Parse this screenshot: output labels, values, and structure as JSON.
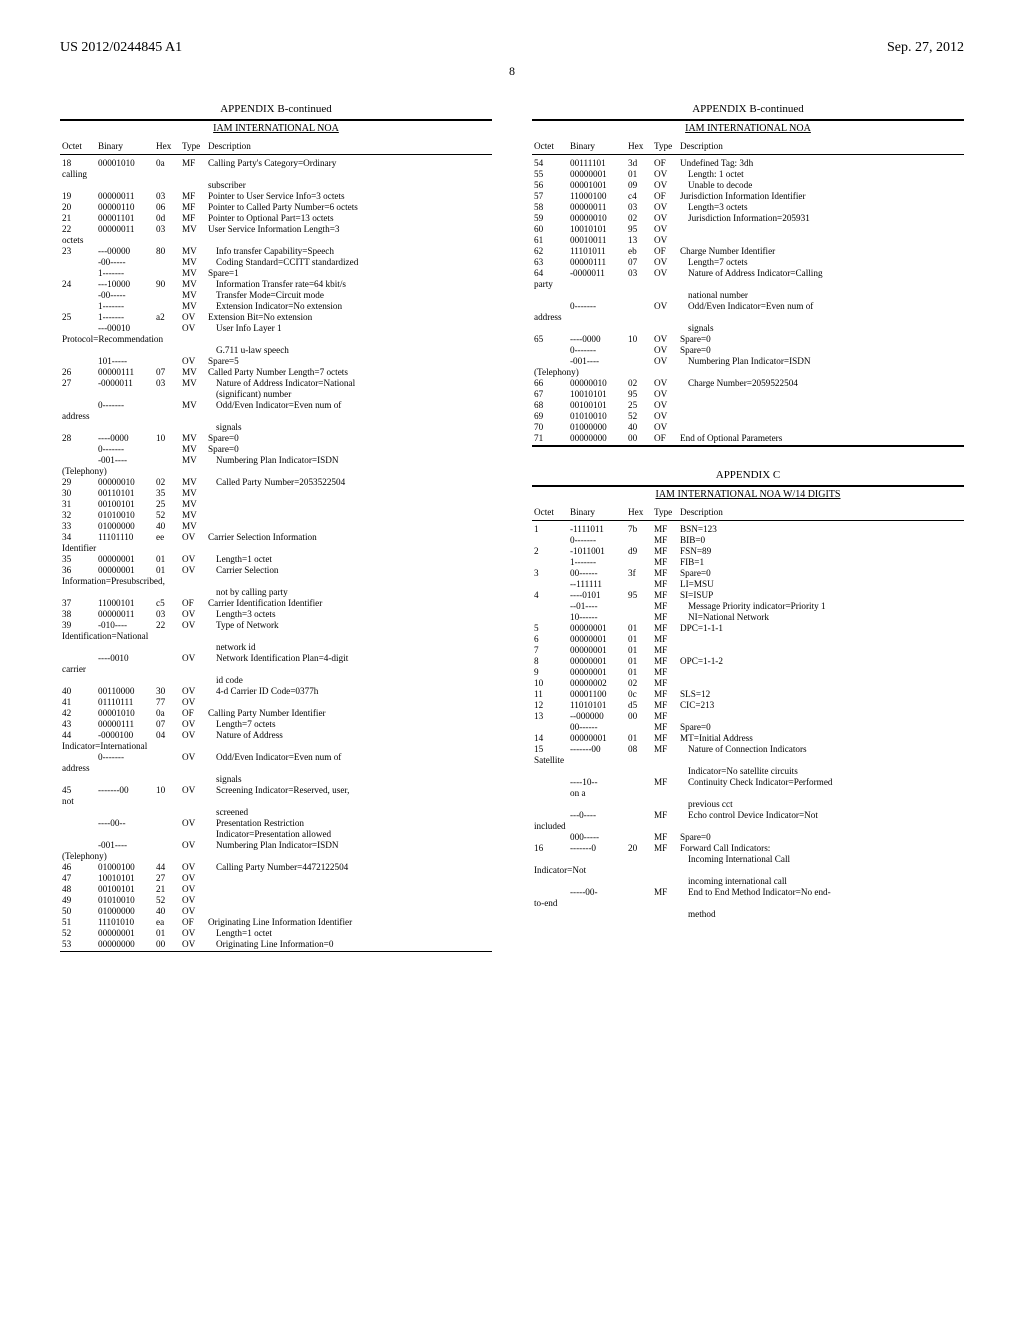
{
  "header": {
    "pub": "US 2012/0244845 A1",
    "date": "Sep. 27, 2012",
    "page": "8"
  },
  "tables": {
    "b_left": {
      "appendix": "APPENDIX B-continued",
      "title": "IAM INTERNATIONAL NOA",
      "cols": [
        "Octet",
        "Binary",
        "Hex",
        "Type",
        "Description"
      ],
      "rows": [
        [
          "18",
          "00001010",
          "0a",
          "MF",
          "Calling Party's Category=Ordinary"
        ],
        [
          "calling",
          "",
          "",
          "",
          ""
        ],
        [
          "",
          "",
          "",
          "",
          "subscriber"
        ],
        [
          "19",
          "00000011",
          "03",
          "MF",
          "Pointer to User Service Info=3 octets"
        ],
        [
          "20",
          "00000110",
          "06",
          "MF",
          "Pointer to Called Party Number=6 octets"
        ],
        [
          "21",
          "00001101",
          "0d",
          "MF",
          "Pointer to Optional Part=13 octets"
        ],
        [
          "22",
          "00000011",
          "03",
          "MV",
          "User Service Information Length=3"
        ],
        [
          "octets",
          "",
          "",
          "",
          ""
        ],
        [
          "23",
          "---00000",
          "80",
          "MV",
          "  Info transfer Capability=Speech"
        ],
        [
          "",
          "-00-----",
          "",
          "MV",
          "  Coding Standard=CCITT standardized"
        ],
        [
          "",
          "1-------",
          "",
          "MV",
          "Spare=1"
        ],
        [
          "24",
          "---10000",
          "90",
          "MV",
          "  Information Transfer rate=64 kbit/s"
        ],
        [
          "",
          "-00-----",
          "",
          "MV",
          "  Transfer Mode=Circuit mode"
        ],
        [
          "",
          "1-------",
          "",
          "MV",
          "  Extension Indicator=No extension"
        ],
        [
          "25",
          "1-------",
          "a2",
          "OV",
          "Extension Bit=No extension"
        ],
        [
          "",
          "---00010",
          "",
          "OV",
          "  User Info Layer 1"
        ],
        [
          "Protocol=Recommendation",
          "",
          "",
          "",
          ""
        ],
        [
          "",
          "",
          "",
          "",
          "  G.711 u-law speech"
        ],
        [
          "",
          "101-----",
          "",
          "OV",
          "Spare=5"
        ],
        [
          "26",
          "00000111",
          "07",
          "MV",
          "Called Party Number Length=7 octets"
        ],
        [
          "27",
          "-0000011",
          "03",
          "MV",
          "  Nature of Address Indicator=National"
        ],
        [
          "",
          "",
          "",
          "",
          "  (significant) number"
        ],
        [
          "",
          "0-------",
          "",
          "MV",
          "  Odd/Even Indicator=Even num of"
        ],
        [
          "address",
          "",
          "",
          "",
          ""
        ],
        [
          "",
          "",
          "",
          "",
          "  signals"
        ],
        [
          "28",
          "----0000",
          "10",
          "MV",
          "Spare=0"
        ],
        [
          "",
          "0-------",
          "",
          "MV",
          "Spare=0"
        ],
        [
          "",
          "-001----",
          "",
          "MV",
          "  Numbering Plan Indicator=ISDN"
        ],
        [
          "(Telephony)",
          "",
          "",
          "",
          ""
        ],
        [
          "29",
          "00000010",
          "02",
          "MV",
          "  Called Party Number=2053522504"
        ],
        [
          "30",
          "00110101",
          "35",
          "MV",
          ""
        ],
        [
          "31",
          "00100101",
          "25",
          "MV",
          ""
        ],
        [
          "32",
          "01010010",
          "52",
          "MV",
          ""
        ],
        [
          "33",
          "01000000",
          "40",
          "MV",
          ""
        ],
        [
          "34",
          "11101110",
          "ee",
          "OV",
          "Carrier Selection Information"
        ],
        [
          "Identifier",
          "",
          "",
          "",
          ""
        ],
        [
          "35",
          "00000001",
          "01",
          "OV",
          "  Length=1 octet"
        ],
        [
          "36",
          "00000001",
          "01",
          "OV",
          "  Carrier Selection"
        ],
        [
          "Information=Presubscribed,",
          "",
          "",
          "",
          ""
        ],
        [
          "",
          "",
          "",
          "",
          "  not by calling party"
        ],
        [
          "37",
          "11000101",
          "c5",
          "OF",
          "Carrier Identification Identifier"
        ],
        [
          "38",
          "00000011",
          "03",
          "OV",
          "  Length=3 octets"
        ],
        [
          "39",
          "-010----",
          "22",
          "OV",
          "  Type of Network"
        ],
        [
          "Identification=National",
          "",
          "",
          "",
          ""
        ],
        [
          "",
          "",
          "",
          "",
          "  network id"
        ],
        [
          "",
          "----0010",
          "",
          "OV",
          "  Network Identification Plan=4-digit"
        ],
        [
          "carrier",
          "",
          "",
          "",
          ""
        ],
        [
          "",
          "",
          "",
          "",
          "  id code"
        ],
        [
          "40",
          "00110000",
          "30",
          "OV",
          "  4-d Carrier ID Code=0377h"
        ],
        [
          "41",
          "01110111",
          "77",
          "OV",
          ""
        ],
        [
          "42",
          "00001010",
          "0a",
          "OF",
          "Calling Party Number Identifier"
        ],
        [
          "43",
          "00000111",
          "07",
          "OV",
          "  Length=7 octets"
        ],
        [
          "44",
          "-0000100",
          "04",
          "OV",
          "  Nature of Address"
        ],
        [
          "Indicator=International",
          "",
          "",
          "",
          ""
        ],
        [
          "",
          "0-------",
          "",
          "OV",
          "  Odd/Even Indicator=Even num of"
        ],
        [
          "address",
          "",
          "",
          "",
          ""
        ],
        [
          "",
          "",
          "",
          "",
          "  signals"
        ],
        [
          "45",
          "-------00",
          "10",
          "OV",
          "  Screening Indicator=Reserved, user,"
        ],
        [
          "not",
          "",
          "",
          "",
          ""
        ],
        [
          "",
          "",
          "",
          "",
          "  screened"
        ],
        [
          "",
          "----00--",
          "",
          "OV",
          "  Presentation Restriction"
        ],
        [
          "",
          "",
          "",
          "",
          "  Indicator=Presentation allowed"
        ],
        [
          "",
          "-001----",
          "",
          "OV",
          "  Numbering Plan Indicator=ISDN"
        ],
        [
          "(Telephony)",
          "",
          "",
          "",
          ""
        ],
        [
          "46",
          "01000100",
          "44",
          "OV",
          "  Calling Party Number=4472122504"
        ],
        [
          "47",
          "10010101",
          "27",
          "OV",
          ""
        ],
        [
          "48",
          "00100101",
          "21",
          "OV",
          ""
        ],
        [
          "49",
          "01010010",
          "52",
          "OV",
          ""
        ],
        [
          "50",
          "01000000",
          "40",
          "OV",
          ""
        ],
        [
          "51",
          "11101010",
          "ea",
          "OF",
          "Originating Line Information Identifier"
        ],
        [
          "52",
          "00000001",
          "01",
          "OV",
          "  Length=1 octet"
        ],
        [
          "53",
          "00000000",
          "00",
          "OV",
          "  Originating Line Information=0"
        ]
      ]
    },
    "b_right": {
      "appendix": "APPENDIX B-continued",
      "title": "IAM INTERNATIONAL NOA",
      "cols": [
        "Octet",
        "Binary",
        "Hex",
        "Type",
        "Description"
      ],
      "rows": [
        [
          "54",
          "00111101",
          "3d",
          "OF",
          "Undefined Tag: 3dh"
        ],
        [
          "55",
          "00000001",
          "01",
          "OV",
          "  Length: 1 octet"
        ],
        [
          "56",
          "00001001",
          "09",
          "OV",
          "  Unable to decode"
        ],
        [
          "57",
          "11000100",
          "c4",
          "OF",
          "Jurisdiction Information Identifier"
        ],
        [
          "58",
          "00000011",
          "03",
          "OV",
          "  Length=3 octets"
        ],
        [
          "59",
          "00000010",
          "02",
          "OV",
          "  Jurisdiction Information=205931"
        ],
        [
          "60",
          "10010101",
          "95",
          "OV",
          ""
        ],
        [
          "61",
          "00010011",
          "13",
          "OV",
          ""
        ],
        [
          "62",
          "11101011",
          "eb",
          "OF",
          "Charge Number Identifier"
        ],
        [
          "63",
          "00000111",
          "07",
          "OV",
          "  Length=7 octets"
        ],
        [
          "64",
          "-0000011",
          "03",
          "OV",
          "  Nature of Address Indicator=Calling"
        ],
        [
          "party",
          "",
          "",
          "",
          ""
        ],
        [
          "",
          "",
          "",
          "",
          "  national number"
        ],
        [
          "",
          "0-------",
          "",
          "OV",
          "  Odd/Even Indicator=Even num of"
        ],
        [
          "address",
          "",
          "",
          "",
          ""
        ],
        [
          "",
          "",
          "",
          "",
          "  signals"
        ],
        [
          "65",
          "----0000",
          "10",
          "OV",
          "Spare=0"
        ],
        [
          "",
          "0-------",
          "",
          "OV",
          "Spare=0"
        ],
        [
          "",
          "-001----",
          "",
          "OV",
          "  Numbering Plan Indicator=ISDN"
        ],
        [
          "(Telephony)",
          "",
          "",
          "",
          ""
        ],
        [
          "66",
          "00000010",
          "02",
          "OV",
          "  Charge Number=2059522504"
        ],
        [
          "67",
          "10010101",
          "95",
          "OV",
          ""
        ],
        [
          "68",
          "00100101",
          "25",
          "OV",
          ""
        ],
        [
          "69",
          "01010010",
          "52",
          "OV",
          ""
        ],
        [
          "70",
          "01000000",
          "40",
          "OV",
          ""
        ],
        [
          "71",
          "00000000",
          "00",
          "OF",
          "End of Optional Parameters"
        ]
      ]
    },
    "c_right": {
      "appendix": "APPENDIX C",
      "title": "IAM INTERNATIONAL NOA W/14 DIGITS",
      "cols": [
        "Octet",
        "Binary",
        "Hex",
        "Type",
        "Description"
      ],
      "rows": [
        [
          "1",
          "-1111011",
          "7b",
          "MF",
          "BSN=123"
        ],
        [
          "",
          "0-------",
          "",
          "MF",
          "BIB=0"
        ],
        [
          "2",
          "-1011001",
          "d9",
          "MF",
          "FSN=89"
        ],
        [
          "",
          "1-------",
          "",
          "MF",
          "FIB=1"
        ],
        [
          "3",
          "00------",
          "3f",
          "MF",
          "Spare=0"
        ],
        [
          "",
          "--111111",
          "",
          "MF",
          "LI=MSU"
        ],
        [
          "4",
          "----0101",
          "95",
          "MF",
          "SI=ISUP"
        ],
        [
          "",
          "--01----",
          "",
          "MF",
          "  Message Priority indicator=Priority 1"
        ],
        [
          "",
          "10------",
          "",
          "MF",
          "  NI=National Network"
        ],
        [
          "5",
          "00000001",
          "01",
          "MF",
          "DPC=1-1-1"
        ],
        [
          "6",
          "00000001",
          "01",
          "MF",
          ""
        ],
        [
          "7",
          "00000001",
          "01",
          "MF",
          ""
        ],
        [
          "8",
          "00000001",
          "01",
          "MF",
          "OPC=1-1-2"
        ],
        [
          "9",
          "00000001",
          "01",
          "MF",
          ""
        ],
        [
          "10",
          "00000002",
          "02",
          "MF",
          ""
        ],
        [
          "11",
          "00001100",
          "0c",
          "MF",
          "SLS=12"
        ],
        [
          "12",
          "11010101",
          "d5",
          "MF",
          "CIC=213"
        ],
        [
          "13",
          "--000000",
          "00",
          "MF",
          ""
        ],
        [
          "",
          "00------",
          "",
          "MF",
          "Spare=0"
        ],
        [
          "14",
          "00000001",
          "01",
          "MF",
          "MT=Initial Address"
        ],
        [
          "15",
          "-------00",
          "08",
          "MF",
          "  Nature of Connection Indicators"
        ],
        [
          "Satellite",
          "",
          "",
          "",
          ""
        ],
        [
          "",
          "",
          "",
          "",
          "  Indicator=No satellite circuits"
        ],
        [
          "",
          "----10--",
          "",
          "MF",
          "  Continuity Check Indicator=Performed"
        ],
        [
          "",
          "    on a",
          "",
          "",
          ""
        ],
        [
          "",
          "",
          "",
          "",
          "  previous cct"
        ],
        [
          "",
          "---0----",
          "",
          "MF",
          "  Echo control Device Indicator=Not"
        ],
        [
          "included",
          "",
          "",
          "",
          ""
        ],
        [
          "",
          "000-----",
          "",
          "MF",
          "Spare=0"
        ],
        [
          "16",
          "-------0",
          "20",
          "MF",
          "Forward Call Indicators:"
        ],
        [
          "",
          "",
          "",
          "",
          "  Incoming International Call"
        ],
        [
          "Indicator=Not",
          "",
          "",
          "",
          ""
        ],
        [
          "",
          "",
          "",
          "",
          "  incoming international call"
        ],
        [
          "",
          "-----00-",
          "",
          "MF",
          "  End to End Method Indicator=No end-"
        ],
        [
          "to-end",
          "",
          "",
          "",
          ""
        ],
        [
          "",
          "",
          "",
          "",
          "  method"
        ]
      ]
    }
  }
}
